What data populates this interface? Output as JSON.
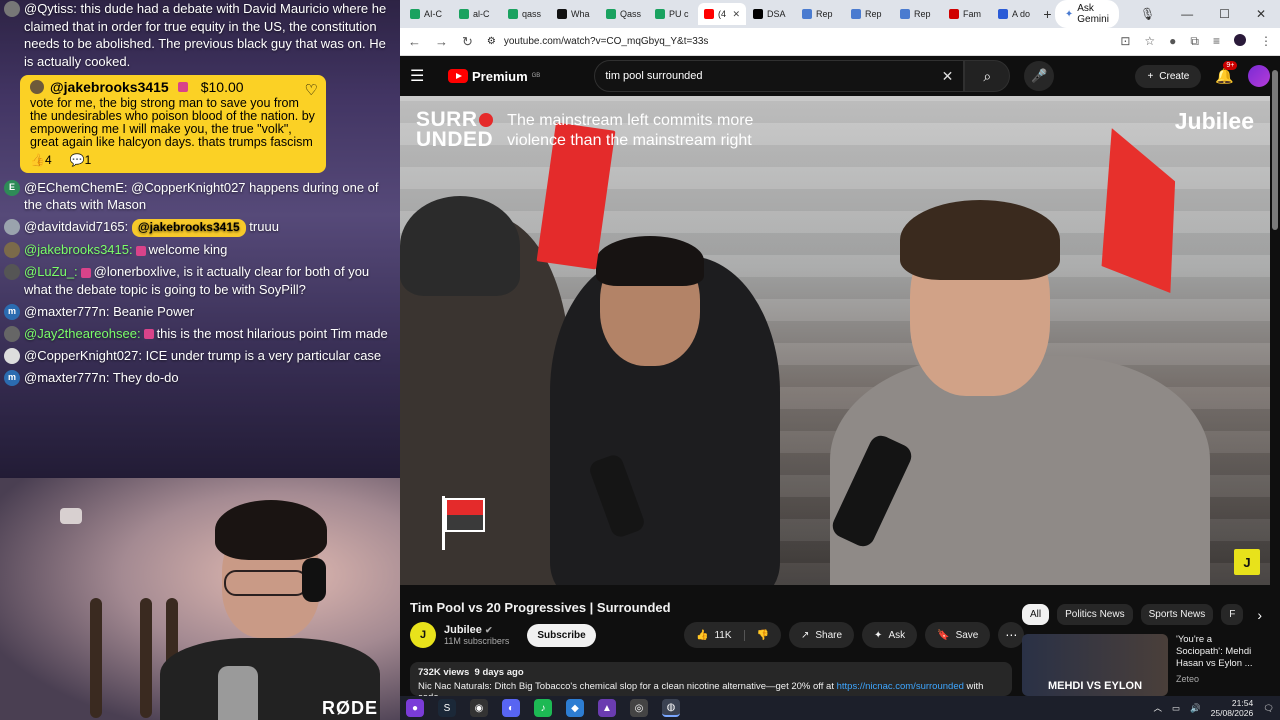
{
  "chat": {
    "messages": [
      {
        "user": "@Qytiss:",
        "text": "this dude had a debate with David Mauricio where he claimed that in order for true equity in the US, the constitution needs to be abolished. The previous black guy that was on. He is actually cooked.",
        "color": "#ffffff",
        "avatar_color": "#777777"
      },
      {
        "user": "@EChemChemE:",
        "text": "@CopperKnight027 happens during one of the chats with Mason",
        "color": "#ffffff",
        "avatar_color": "#2e8b57",
        "avatar_letter": "E"
      },
      {
        "user": "@davitdavid7165:",
        "mention": "@jakebrooks3415",
        "text": "truuu",
        "color": "#ffffff",
        "avatar_color": "#9aa3ad"
      },
      {
        "user": "@jakebrooks3415:",
        "text": "welcome king",
        "color": "#7bff6a",
        "avatar_color": "#7b6a4a",
        "badge": true
      },
      {
        "user": "@LuZu_:",
        "text": "@lonerboxlive, is it actually clear for both of you what the debate topic is going to be with SoyPill?",
        "color": "#7bff6a",
        "avatar_color": "#555555",
        "badge": true
      },
      {
        "user": "@maxter777n:",
        "text": "Beanie Power",
        "color": "#ffffff",
        "avatar_color": "#2b6cb0",
        "avatar_letter": "m"
      },
      {
        "user": "@Jay2theareohsee:",
        "text": "this is the most hilarious point Tim made",
        "color": "#7bff6a",
        "avatar_color": "#666666",
        "badge": true
      },
      {
        "user": "@CopperKnight027:",
        "text": "ICE under trump is a very particular case",
        "color": "#ffffff",
        "avatar_color": "#dddddd"
      },
      {
        "user": "@maxter777n:",
        "text": "They do-do",
        "color": "#ffffff",
        "avatar_color": "#2b6cb0",
        "avatar_letter": "m"
      }
    ],
    "superchat": {
      "user": "@jakebrooks3415",
      "amount": "$10.00",
      "text": "vote for me, the big strong man to save you from the undesirables who poison blood of the nation. by empowering me I will make you, the true \"volk\", great again like halcyon days. thats trumps fascism",
      "likes": "4",
      "comments": "1"
    }
  },
  "webcam": {
    "mic_brand": "RØDE"
  },
  "browser": {
    "tabs": [
      {
        "label": "AI-C",
        "color": "#1aa260"
      },
      {
        "label": "al-C",
        "color": "#1aa260"
      },
      {
        "label": "qass",
        "color": "#1aa260"
      },
      {
        "label": "Wha",
        "color": "#111111"
      },
      {
        "label": "Qass",
        "color": "#1aa260"
      },
      {
        "label": "PU c",
        "color": "#1aa260"
      },
      {
        "label": "(4",
        "color": "#ff0000",
        "active": true
      },
      {
        "label": "DSA",
        "color": "#000000"
      },
      {
        "label": "Rep",
        "color": "#4a7bd0"
      },
      {
        "label": "Rep",
        "color": "#4a7bd0"
      },
      {
        "label": "Rep",
        "color": "#4a7bd0"
      },
      {
        "label": "Fam",
        "color": "#d00000"
      },
      {
        "label": "A do",
        "color": "#2a5bd7"
      }
    ],
    "new_tab": "+",
    "gemini_label": "Ask Gemini",
    "url": "youtube.com/watch?v=CO_mqGbyq_Y&t=33s"
  },
  "youtube": {
    "logo": "Premium",
    "logo_sup": "GB",
    "search_value": "tim pool surrounded",
    "create_label": "Create",
    "notif_count": "9+",
    "video_overlay": {
      "brand_line1": "SURR",
      "brand_line2": "UNDED",
      "quote_line1": "The mainstream left commits more",
      "quote_line2": "violence than the mainstream right",
      "channel_wordmark": "Jubilee"
    },
    "video_title": "Tim Pool vs 20 Progressives | Surrounded",
    "channel_name": "Jubilee",
    "channel_subs": "11M subscribers",
    "subscribe_label": "Subscribe",
    "likes": "11K",
    "share_label": "Share",
    "ask_label": "Ask",
    "save_label": "Save",
    "views": "732K views",
    "age": "9 days ago",
    "desc_text": "Nic Nac Naturals: Ditch Big Tobacco's chemical slop for a clean nicotine alternative—get 20% off at",
    "desc_link": "https://nicnac.com/surrounded",
    "desc_tail": "with code",
    "chips": [
      "All",
      "Politics News",
      "Sports News",
      "F"
    ],
    "rec": {
      "thumb_caption": "MEHDI VS EYLON",
      "title": "'You're a Sociopath': Mehdi Hasan vs Eylon ...",
      "channel": "Zeteo"
    }
  },
  "taskbar": {
    "time": "21:54",
    "date": "25/08/2026"
  }
}
